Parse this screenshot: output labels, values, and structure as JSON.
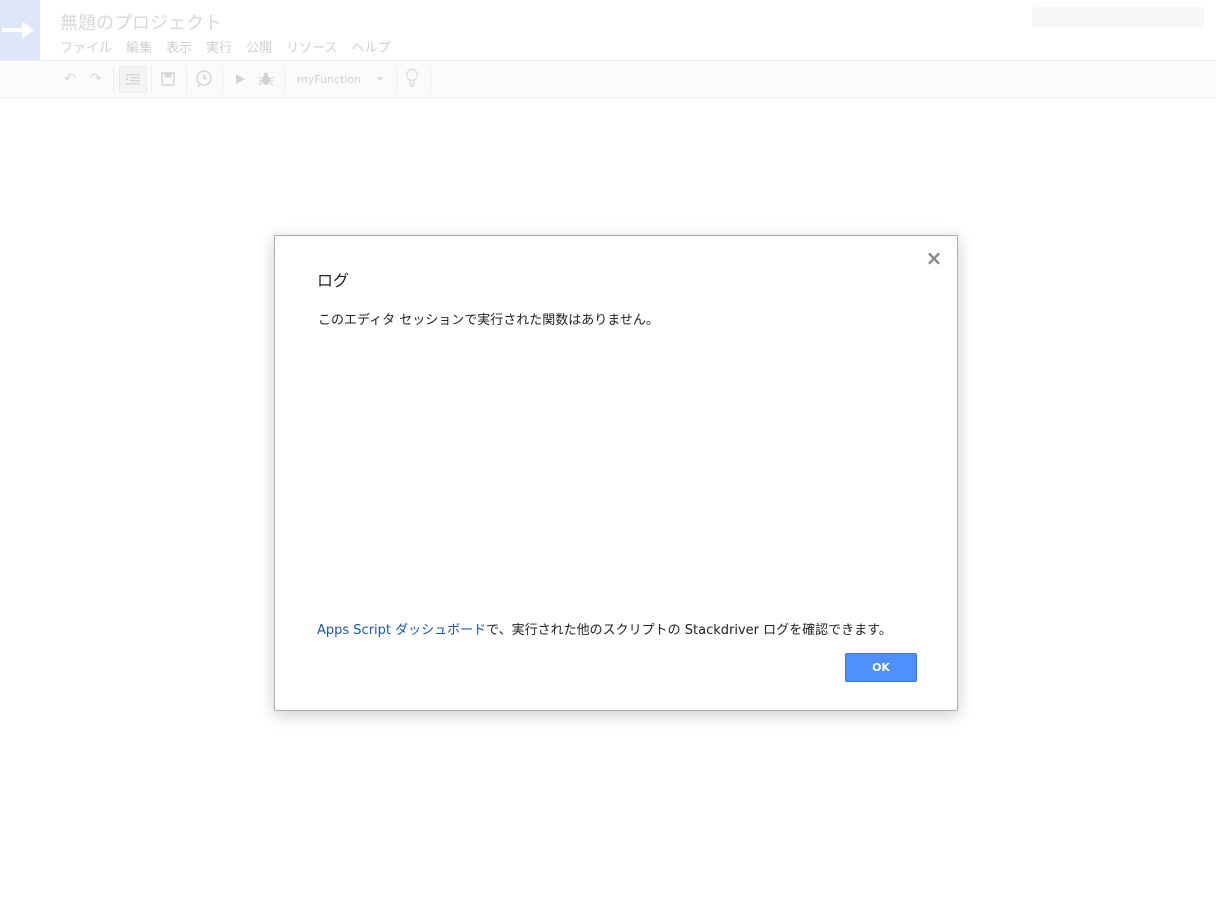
{
  "header": {
    "project_title": "無題のプロジェクト",
    "menu": [
      "ファイル",
      "編集",
      "表示",
      "実行",
      "公開",
      "リソース",
      "ヘルプ"
    ]
  },
  "toolbar": {
    "function_select": "myFunction"
  },
  "dialog": {
    "title": "ログ",
    "message": "このエディタ セッションで実行された関数はありません。",
    "footer_link": "Apps Script ダッシュボード",
    "footer_text": "で、実行された他のスクリプトの Stackdriver ログを確認できます。",
    "close_label": "×",
    "ok_label": "OK"
  },
  "colors": {
    "ok_button": "#4d90fe",
    "link": "#1a56b3"
  }
}
